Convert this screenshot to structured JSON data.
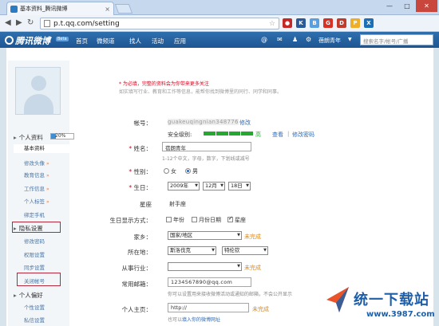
{
  "browser": {
    "tab_title": "基本资料_腾讯微博",
    "tab_close": "×",
    "url": "p.t.qq.com/setting",
    "window_controls": {
      "minimize": "—",
      "maximize": "□",
      "close": "✕"
    },
    "extensions": [
      {
        "name": "stop-icon",
        "label": "●",
        "color": "#c62828"
      },
      {
        "name": "extension-k-icon",
        "label": "K",
        "color": "#2a5a9a"
      },
      {
        "name": "extension-b-icon",
        "label": "B",
        "color": "#5aa0e0"
      },
      {
        "name": "extension-g-icon",
        "label": "G",
        "color": "#d93025"
      },
      {
        "name": "extension-d-icon",
        "label": "D",
        "color": "#c23a2b"
      },
      {
        "name": "extension-p-icon",
        "label": "P",
        "color": "#f0ad28"
      },
      {
        "name": "extension-x-icon",
        "label": "X",
        "color": "#1b6fb8"
      }
    ]
  },
  "site": {
    "logo": "腾讯微博",
    "beta": "Beta",
    "nav": [
      "首页",
      "微频道",
      "找人",
      "活动",
      "应用"
    ],
    "user_name": "蓓朗青年",
    "search_placeholder": "搜索名字/帐号/广播"
  },
  "sidebar": {
    "profile_section": "个人资料",
    "profile_progress": "20%",
    "profile_progress_value": 0.2,
    "profile_items": [
      "基本资料",
      "修改头像",
      "教育信息",
      "工作信息",
      "个人标签",
      "绑定手机"
    ],
    "privacy_section": "隐私设置",
    "privacy_items": [
      "修改密码",
      "权限设置",
      "同步设置",
      "关闭帐号"
    ],
    "prefs_section": "个人偏好",
    "prefs_items": [
      "个性设置",
      "私信设置"
    ]
  },
  "form": {
    "note_line1": "* 为必填，完整的资料会为你带来更多关注",
    "note_line2": "如实填写行业、教育和工作等信息，能帮你找到微博里的同行、同学和同事。",
    "account_label": "帐号：",
    "account_value": "guakeuqingnian348776",
    "account_edit": "修改",
    "security_label": "安全级别:",
    "security_level": "高",
    "security_view": "查看",
    "security_change_pwd": "修改密码",
    "name_label": "姓名：",
    "name_value": "蓓朗青年",
    "name_hint": "1-12个中文，字母，数字，下划线或减号",
    "gender_label": "性别：",
    "gender_female": "女",
    "gender_male": "男",
    "birthday_label": "生日：",
    "birth_year": "2009年",
    "birth_month": "12月",
    "birth_day": "18日",
    "zodiac_label": "星座",
    "zodiac_value": "射手座",
    "birth_display_label": "生日显示方式：",
    "display_year": "年份",
    "display_monthday": "月份日期",
    "display_zodiac": "星座",
    "hometown_label": "家乡：",
    "hometown_value": "国家/地区",
    "incomplete": "未完成",
    "location_label": "所在地：",
    "location_country": "斯洛伐克",
    "location_region": "特伦钦",
    "industry_label": "从事行业：",
    "industry_value": "",
    "email_label": "常用邮箱：",
    "email_value": "1234567890@qq.com",
    "email_hint": "你可以设置用来接收微博活动或通知的邮箱，不会公开显示",
    "homepage_label": "个人主页：",
    "homepage_value": "http://",
    "homepage_hint_prefix": "也可以",
    "homepage_hint_link": "填入你的微博网址"
  },
  "watermark": {
    "title": "统一下载站",
    "url": "www.3987.com"
  }
}
